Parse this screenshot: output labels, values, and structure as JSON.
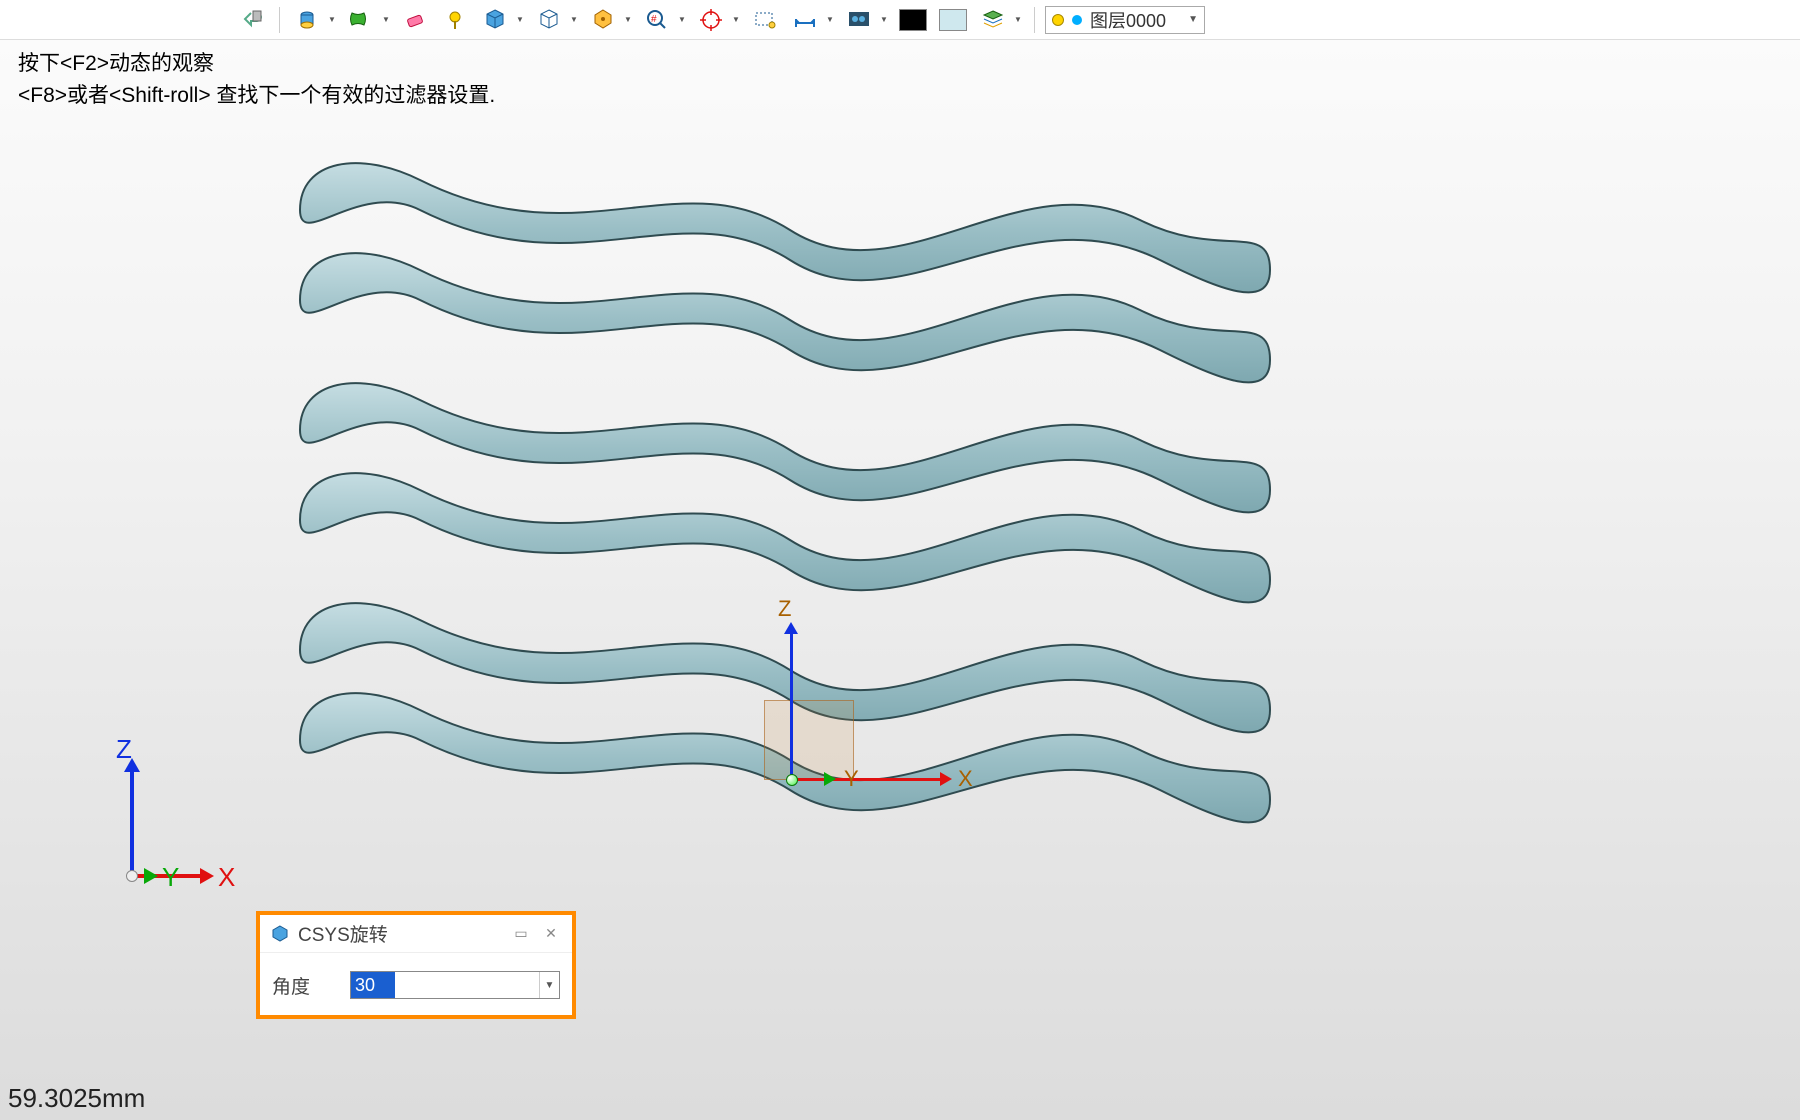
{
  "hints": {
    "line1": "按下<F2>动态的观察",
    "line2": "<F8>或者<Shift-roll> 查找下一个有效的过滤器设置."
  },
  "toolbar": {
    "layer_label": "图层0000"
  },
  "triad": {
    "x": "X",
    "y": "Y",
    "z": "Z"
  },
  "csys_triad": {
    "x": "X",
    "y": "Y",
    "z": "Z"
  },
  "dialog": {
    "title": "CSYS旋转",
    "angle_label": "角度",
    "angle_value": "30"
  },
  "status": {
    "measurement": "59.3025mm"
  },
  "colors": {
    "accent_orange": "#ff8a00",
    "model_fill": "#a5c4ca",
    "model_edge": "#2f4b50",
    "axis_x": "#e01010",
    "axis_y": "#08a808",
    "axis_z": "#1030e0"
  }
}
